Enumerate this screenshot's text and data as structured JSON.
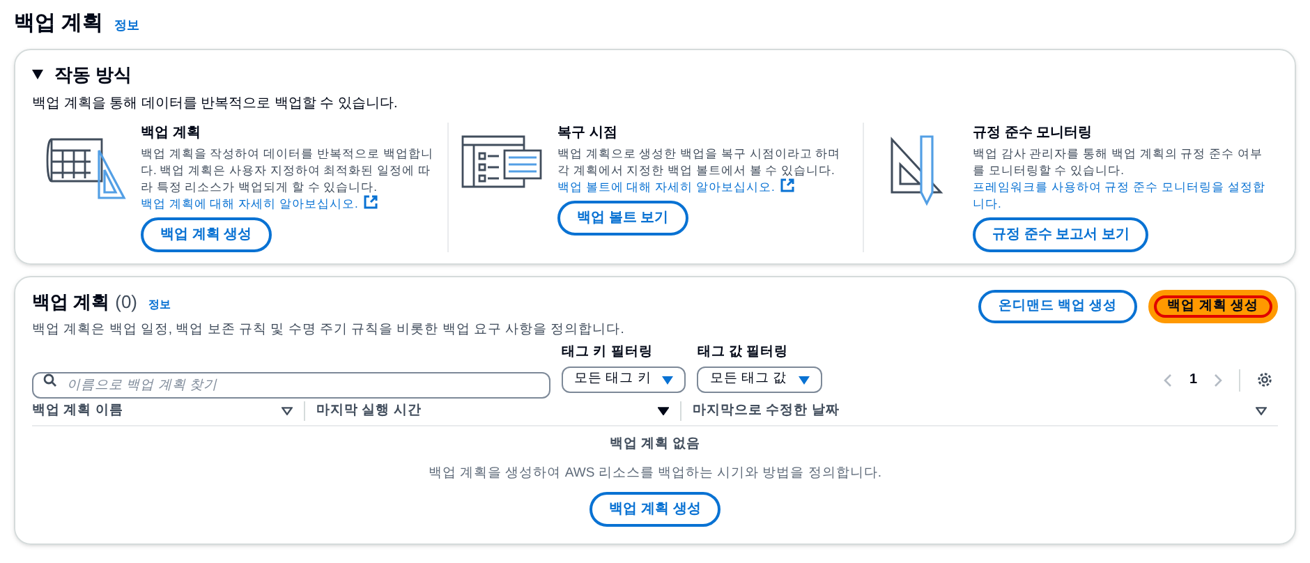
{
  "page": {
    "title": "백업 계획",
    "info_link": "정보"
  },
  "how_it_works": {
    "title": "작동 방식",
    "expanded": true,
    "description": "백업 계획을 통해 데이터를 반복적으로 백업할 수 있습니다.",
    "cards": [
      {
        "kind": "plan",
        "title": "백업 계획",
        "text": "백업 계획을 작성하여 데이터를 반복적으로 백업합니다. 백업 계획은 사용자 지정하여 최적화된 일정에 따라 특정 리소스가 백업되게 할 수 있습니다.",
        "link": "백업 계획에 대해 자세히 알아보십시오.",
        "external": true,
        "button": "백업 계획 생성"
      },
      {
        "kind": "vault",
        "title": "복구 시점",
        "text": "백업 계획으로 생성한 백업을 복구 시점이라고 하며 각 계획에서 지정한 백업 볼트에서 볼 수 있습니다.",
        "link": "백업 볼트에 대해 자세히 알아보십시오.",
        "external": true,
        "button": "백업 볼트 보기"
      },
      {
        "kind": "compliance",
        "title": "규정 준수 모니터링",
        "text": "백업 감사 관리자를 통해 백업 계획의 규정 준수 여부를 모니터링할 수 있습니다.",
        "link": "프레임워크를 사용하여 규정 준수 모니터링을 설정합니다.",
        "external": false,
        "button": "규정 준수 보고서 보기"
      }
    ]
  },
  "plans": {
    "title": "백업 계획",
    "count": "(0)",
    "info_link": "정보",
    "description": "백업 계획은 백업 일정, 백업 보존 규칙 및 수명 주기 규칙을 비롯한 백업 요구 사항을 정의합니다.",
    "actions": [
      {
        "label": "온디맨드 백업 생성",
        "primary": false,
        "highlighted": false
      },
      {
        "label": "백업 계획 생성",
        "primary": true,
        "highlighted": true
      }
    ],
    "search": {
      "placeholder": "이름으로 백업 계획 찾기"
    },
    "filters": [
      {
        "label": "태그 키 필터링",
        "value": "모든 태그 키"
      },
      {
        "label": "태그 값 필터링",
        "value": "모든 태그 값"
      }
    ],
    "pagination": {
      "page": "1",
      "prev_disabled": true,
      "next_disabled": true
    },
    "columns": [
      {
        "label": "백업 계획 이름",
        "sorted": false
      },
      {
        "label": "마지막 실행 시간",
        "sorted": true
      },
      {
        "label": "마지막으로 수정한 날짜",
        "sorted": false
      }
    ],
    "empty": {
      "title": "백업 계획 없음",
      "text": "백업 계획을 생성하여 AWS 리소스를 백업하는 시기와 방법을 정의합니다.",
      "button": "백업 계획 생성"
    }
  }
}
